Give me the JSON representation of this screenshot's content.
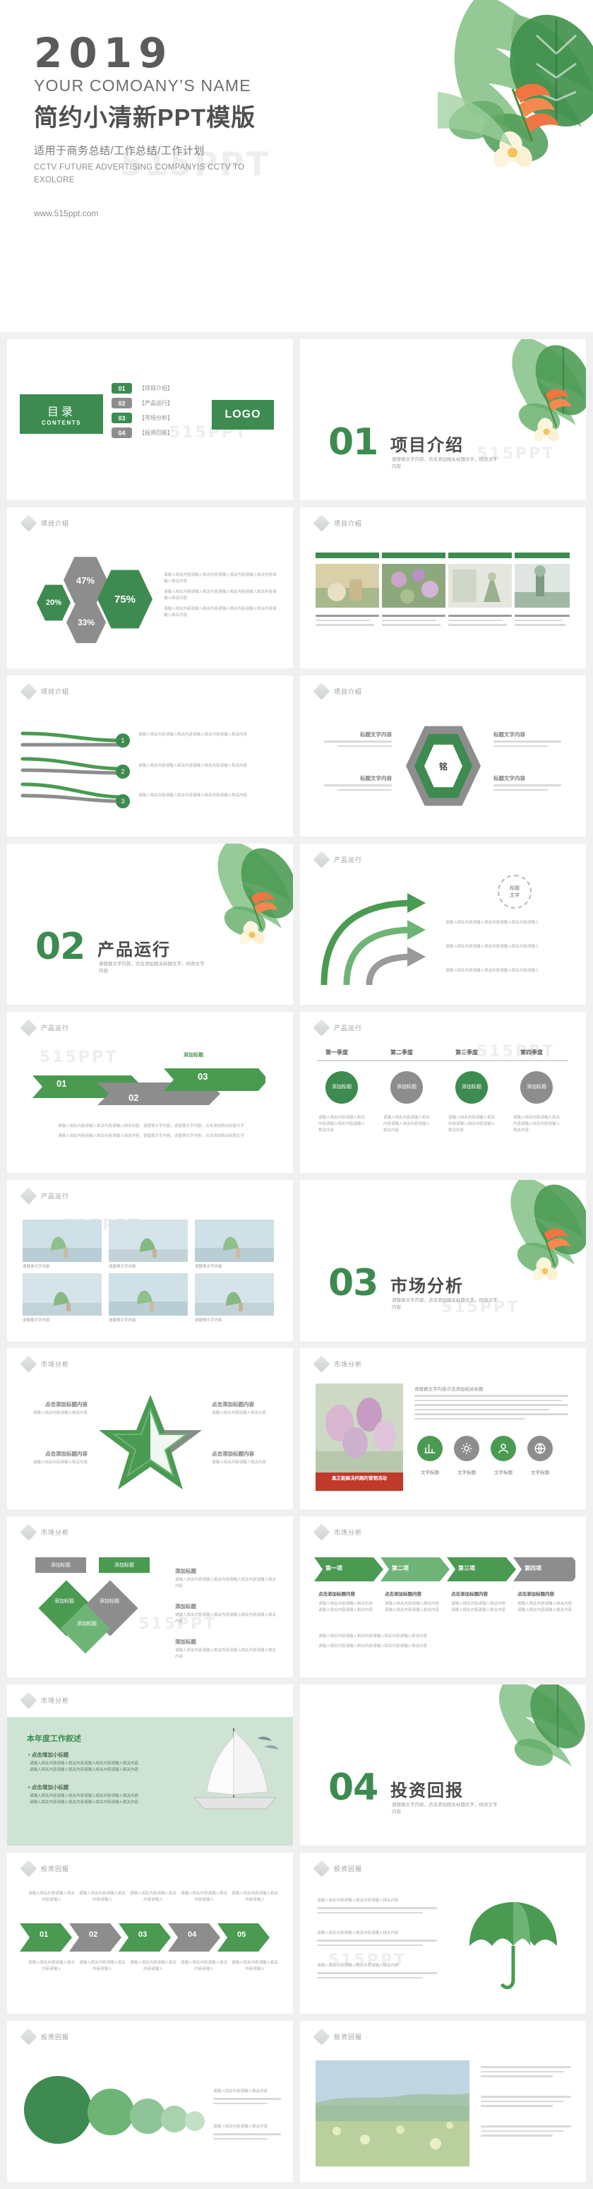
{
  "cover": {
    "year": "2019",
    "company_en": "YOUR COMOANY’S NAME",
    "title_cn": "简约小清新PPT模版",
    "subtitle_cn": "适用于商务总结/工作总结/工作计划",
    "en_line": "CCTV FUTURE ADVERTISING COMPANYIS CCTV TO EXOLORE",
    "url": "www.515ppt.com",
    "watermark": "515PPT"
  },
  "colors": {
    "green": "#3d8b50",
    "green_light": "#5aa86c",
    "grey": "#8d8d8d",
    "grey_light": "#b4b4b4",
    "mint": "#cfe3d4",
    "page_bg": "#f0f0f0"
  },
  "headers": {
    "intro": "项目介绍",
    "product": "产品运行",
    "market": "市场分析",
    "invest": "投资回报"
  },
  "contents": {
    "cn": "目录",
    "en": "CONTENTS",
    "logo": "LOGO",
    "items": [
      {
        "num": "01",
        "label": "【项目介绍】",
        "color": "green"
      },
      {
        "num": "02",
        "label": "【产品运行】",
        "color": "grey"
      },
      {
        "num": "03",
        "label": "【市场分析】",
        "color": "green"
      },
      {
        "num": "04",
        "label": "【投资回报】",
        "color": "grey"
      }
    ]
  },
  "sections": [
    {
      "num": "01",
      "title": "项目介绍",
      "desc": "请替换文字内容，点击添加相关标题文字，修改文字内容"
    },
    {
      "num": "02",
      "title": "产品运行",
      "desc": "请替换文字内容，点击添加相关标题文字，修改文字内容"
    },
    {
      "num": "03",
      "title": "市场分析",
      "desc": "请替换文字内容，点击添加相关标题文字，修改文字内容"
    },
    {
      "num": "04",
      "title": "投资回报",
      "desc": "请替换文字内容，点击添加相关标题文字，修改文字内容"
    }
  ],
  "common": {
    "body_text": "请输入相关内容请输入相关内容请输入相关内容请输入相关内容",
    "sub_title": "点击增加小标题",
    "add_title": "添加标题",
    "title_text": "标题文字",
    "text_label": "文字标题"
  },
  "slide_hex": {
    "percents": [
      "20%",
      "47%",
      "33%",
      "75%"
    ],
    "body": "请输入相关内容请输入相关内容请输入相关内容请输入相关内容请输入相关内容"
  },
  "slide_list": {
    "nums": [
      "1",
      "2",
      "3"
    ],
    "body": "请输入相关内容请输入相关内容请输入相关内容请输入相关内容"
  },
  "slide_hexring": {
    "center": "铭",
    "labels": [
      "标题文字内容",
      "标题文字内容",
      "标题文字内容",
      "标题文字内容"
    ]
  },
  "slide_badge": {
    "badge_line1": "标题",
    "badge_line2": "文字",
    "rows": [
      "请输入相关内容请输入相关内容请输入相关内容请输入",
      "请输入相关内容请输入相关内容请输入相关内容请输入",
      "请输入相关内容请输入相关内容请输入相关内容请输入"
    ]
  },
  "slide_ribbon": {
    "nums": [
      "01",
      "02",
      "03"
    ],
    "title": "添加标题",
    "body": "请输入相关内容请输入相关内容请输入相关内容，请替换文字内容。请替换文字内容，点击添加相关标题文字"
  },
  "slide_quarters": {
    "headers": [
      "第一季度",
      "第二季度",
      "第三季度",
      "第四季度"
    ],
    "cards": [
      "添加\n标题",
      "添加\n标题",
      "添加\n标题",
      "添加\n标题"
    ]
  },
  "slide_gallery": {
    "captions": [
      "请替换文字内容",
      "请替换文字内容",
      "请替换文字内容",
      "请替换文字内容",
      "请替换文字内容",
      "请替换文字内容"
    ]
  },
  "slide_star": {
    "labels": [
      "点击添加标题内容",
      "点击添加标题内容",
      "点击添加标题内容",
      "点击添加标题内容"
    ],
    "body": "请输入相关内容请输入相关内容"
  },
  "slide_icons": {
    "title": "请替换文字内容点击添加相关标题",
    "labels": [
      "文字标题",
      "文字标题",
      "文字标题",
      "文字标题"
    ],
    "poster": "真正能解决问题的营销活动"
  },
  "slide_diamond": {
    "labels": [
      "添加\n标题",
      "添加\n标题",
      "添加标题",
      "添加标题",
      "添加标题"
    ]
  },
  "slide_steps": {
    "steps": [
      "第一项",
      "第二项",
      "第三项",
      "第四项"
    ],
    "captions": [
      "点击添加标题内容",
      "点击添加标题内容",
      "点击添加标题内容",
      "点击添加标题内容"
    ]
  },
  "slide_report": {
    "title": "本年度工作叙述",
    "sub1": "点击增加小标题",
    "sub2": "点击增加小标题",
    "body": "请输入相关内容请输入相关内容请输入相关内容请输入相关内容"
  },
  "slide_arrows5": {
    "nums": [
      "01",
      "02",
      "03",
      "04",
      "05"
    ],
    "caption": "请输入相关内容请输入相关内容请输入"
  },
  "slide_umbrella": {
    "body": "请输入相关内容请输入相关内容请输入相关内容"
  },
  "slide_bubbles": {
    "body": "请输入相关内容请输入相关内容"
  }
}
